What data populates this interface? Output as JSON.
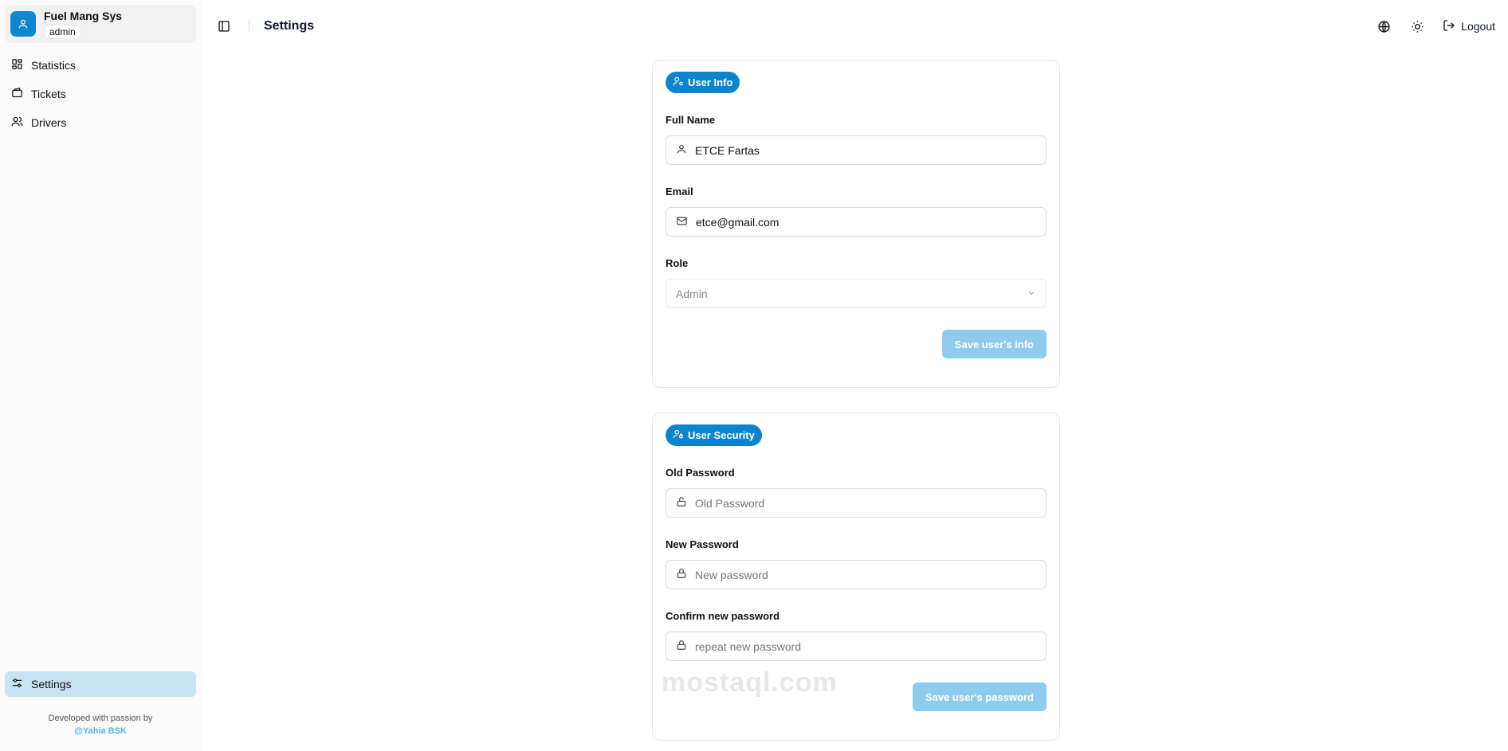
{
  "sidebar": {
    "brand_name": "Fuel Mang Sys",
    "brand_role": "admin",
    "items": [
      {
        "label": "Statistics",
        "icon": "grid-icon"
      },
      {
        "label": "Tickets",
        "icon": "wallet-icon"
      },
      {
        "label": "Drivers",
        "icon": "users-icon"
      }
    ],
    "settings_label": "Settings",
    "footer_text": "Developed with passion by",
    "footer_link": "@Yahia BSK"
  },
  "header": {
    "title": "Settings",
    "logout_label": "Logout"
  },
  "user_info": {
    "badge": "User Info",
    "full_name_label": "Full Name",
    "full_name_value": "ETCE Fartas",
    "email_label": "Email",
    "email_value": "etce@gmail.com",
    "role_label": "Role",
    "role_value": "Admin",
    "save_label": "Save user's info"
  },
  "user_security": {
    "badge": "User Security",
    "old_label": "Old Password",
    "old_placeholder": "Old Password",
    "new_label": "New Password",
    "new_placeholder": "New password",
    "confirm_label": "Confirm new password",
    "confirm_placeholder": "repeat new password",
    "save_label": "Save user's password"
  },
  "watermark": "mostaql.com",
  "colors": {
    "accent": "#0b84cb",
    "button_disabled": "#8ecbec",
    "active_nav": "#c8e4f3"
  }
}
